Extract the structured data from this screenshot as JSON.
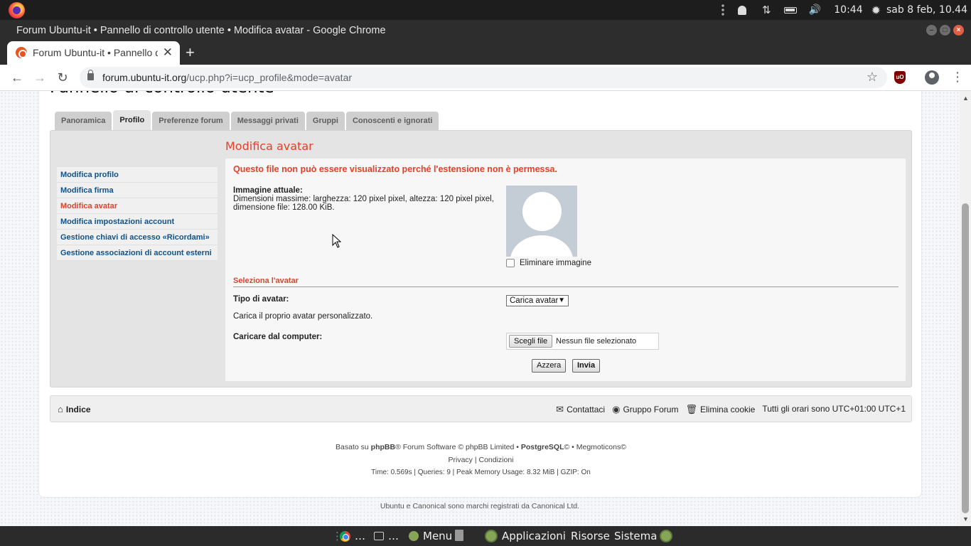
{
  "system": {
    "clock": "10:44",
    "date": "sab  8 feb, 10.44"
  },
  "browser": {
    "window_title": "Forum Ubuntu-it • Pannello di controllo utente • Modifica avatar - Google Chrome",
    "tab_title": "Forum Ubuntu-it • Pannello di controllo utente • Modifica avatar",
    "url_host": "forum.ubuntu-it.org",
    "url_path": "/ucp.php?i=ucp_profile&mode=avatar"
  },
  "page": {
    "title": "Pannello di controllo utente",
    "tabs": [
      {
        "label": "Panoramica"
      },
      {
        "label": "Profilo"
      },
      {
        "label": "Preferenze forum"
      },
      {
        "label": "Messaggi privati"
      },
      {
        "label": "Gruppi"
      },
      {
        "label": "Conoscenti e ignorati"
      }
    ],
    "active_tab": "Profilo",
    "menu": [
      {
        "label": "Modifica profilo"
      },
      {
        "label": "Modifica firma"
      },
      {
        "label": "Modifica avatar"
      },
      {
        "label": "Modifica impostazioni account"
      },
      {
        "label": "Gestione chiavi di accesso «Ricordami»"
      },
      {
        "label": "Gestione associazioni di account esterni"
      }
    ],
    "active_menu": "Modifica avatar",
    "section_title": "Modifica avatar",
    "error": "Questo file non può essere visualizzato perché l'estensione non è permessa.",
    "current_image_label": "Immagine attuale:",
    "current_image_desc_1": "Dimensioni massime: larghezza: 120 pixel pixel, altezza: 120 pixel pixel,",
    "current_image_desc_2": "dimensione file: 128.00 KiB.",
    "delete_label": "Eliminare immagine",
    "select_avatar_title": "Seleziona l'avatar",
    "avatar_type_label": "Tipo di avatar:",
    "avatar_type_value": "Carica avatar",
    "upload_desc": "Carica il proprio avatar personalizzato.",
    "upload_label": "Caricare dal computer:",
    "choose_file": "Scegli file",
    "no_file": "Nessun file selezionato",
    "reset": "Azzera",
    "submit": "Invia"
  },
  "footer": {
    "home": "Indice",
    "contact": "Contattaci",
    "group": "Gruppo Forum",
    "cookies": "Elimina cookie",
    "timezone": "Tutti gli orari sono UTC+01:00 UTC+1",
    "powered_pre": "Basato su ",
    "powered_phpbb": "phpBB",
    "powered_mid": "® Forum Software © phpBB Limited • ",
    "powered_pg": "PostgreSQL",
    "powered_post": "© • Megmoticons©",
    "privacy": "Privacy",
    "sep": " | ",
    "terms": "Condizioni",
    "stats": "Time: 0.569s | Queries: 9 | Peak Memory Usage: 8.32 MiB | GZIP: On",
    "trademark": "Ubuntu e Canonical sono marchi registrati da Canonical Ltd."
  },
  "taskbar": {
    "chrome_ellipsis": "…",
    "term_ellipsis": "…",
    "menu": "Menu",
    "apps": "Applicazioni",
    "places": "Risorse",
    "system": "Sistema"
  },
  "colors": {
    "accent_red": "#e4402a",
    "link_blue": "#105289"
  }
}
